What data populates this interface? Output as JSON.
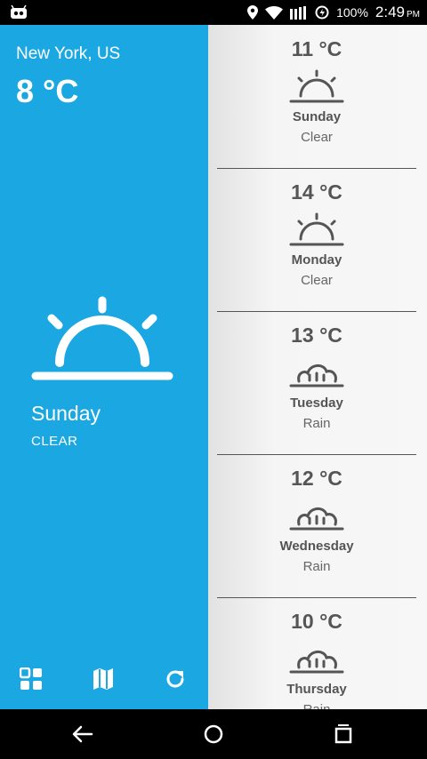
{
  "status_bar": {
    "battery_percent": "100%",
    "time": "2:49",
    "ampm": "PM",
    "icons": [
      "android-debug-icon",
      "location-icon",
      "wifi-icon",
      "signal-icon",
      "data-saver-icon"
    ]
  },
  "current": {
    "city": "New York, US",
    "temp": "8 °C",
    "day": "Sunday",
    "condition": "CLEAR",
    "icon": "sunrise-icon"
  },
  "forecast": [
    {
      "temp": "11 °C",
      "day": "Sunday",
      "condition": "Clear",
      "icon": "sunrise-icon"
    },
    {
      "temp": "14 °C",
      "day": "Monday",
      "condition": "Clear",
      "icon": "sunrise-icon"
    },
    {
      "temp": "13 °C",
      "day": "Tuesday",
      "condition": "Rain",
      "icon": "rain-cloud-icon"
    },
    {
      "temp": "12 °C",
      "day": "Wednesday",
      "condition": "Rain",
      "icon": "rain-cloud-icon"
    },
    {
      "temp": "10 °C",
      "day": "Thursday",
      "condition": "Rain",
      "icon": "rain-cloud-icon"
    }
  ],
  "toolbar": {
    "icons": [
      "dashboard-icon",
      "map-icon",
      "refresh-icon"
    ]
  },
  "navigation_bar": {
    "icons": [
      "back-icon",
      "home-icon",
      "recents-icon"
    ]
  },
  "colors": {
    "accent": "#1aa7e2",
    "text_gray": "#555555",
    "panel_bg": "#f5f5f5"
  }
}
